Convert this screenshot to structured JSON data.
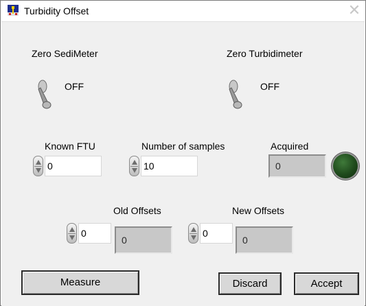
{
  "window": {
    "title": "Turbidity Offset",
    "close_glyph": "✕",
    "icon": "labview-vi-icon"
  },
  "switches": {
    "sedimeter": {
      "label": "Zero SediMeter",
      "state": "OFF"
    },
    "turbidimeter": {
      "label": "Zero Turbidimeter",
      "state": "OFF"
    }
  },
  "inputs": {
    "known_ftu": {
      "label": "Known FTU",
      "value": "0"
    },
    "samples": {
      "label": "Number of samples",
      "value": "10"
    },
    "acquired": {
      "label": "Acquired",
      "value": "0",
      "led_on": false
    }
  },
  "offsets": {
    "old": {
      "label": "Old Offsets",
      "control": "0",
      "indicator": "0"
    },
    "new": {
      "label": "New Offsets",
      "control": "0",
      "indicator": "0"
    }
  },
  "buttons": {
    "measure": "Measure",
    "discard": "Discard",
    "accept": "Accept"
  },
  "colors": {
    "led_off": "#1f4a1c",
    "panel": "#f0f0f0",
    "indicator_bg": "#c8c8c8"
  }
}
